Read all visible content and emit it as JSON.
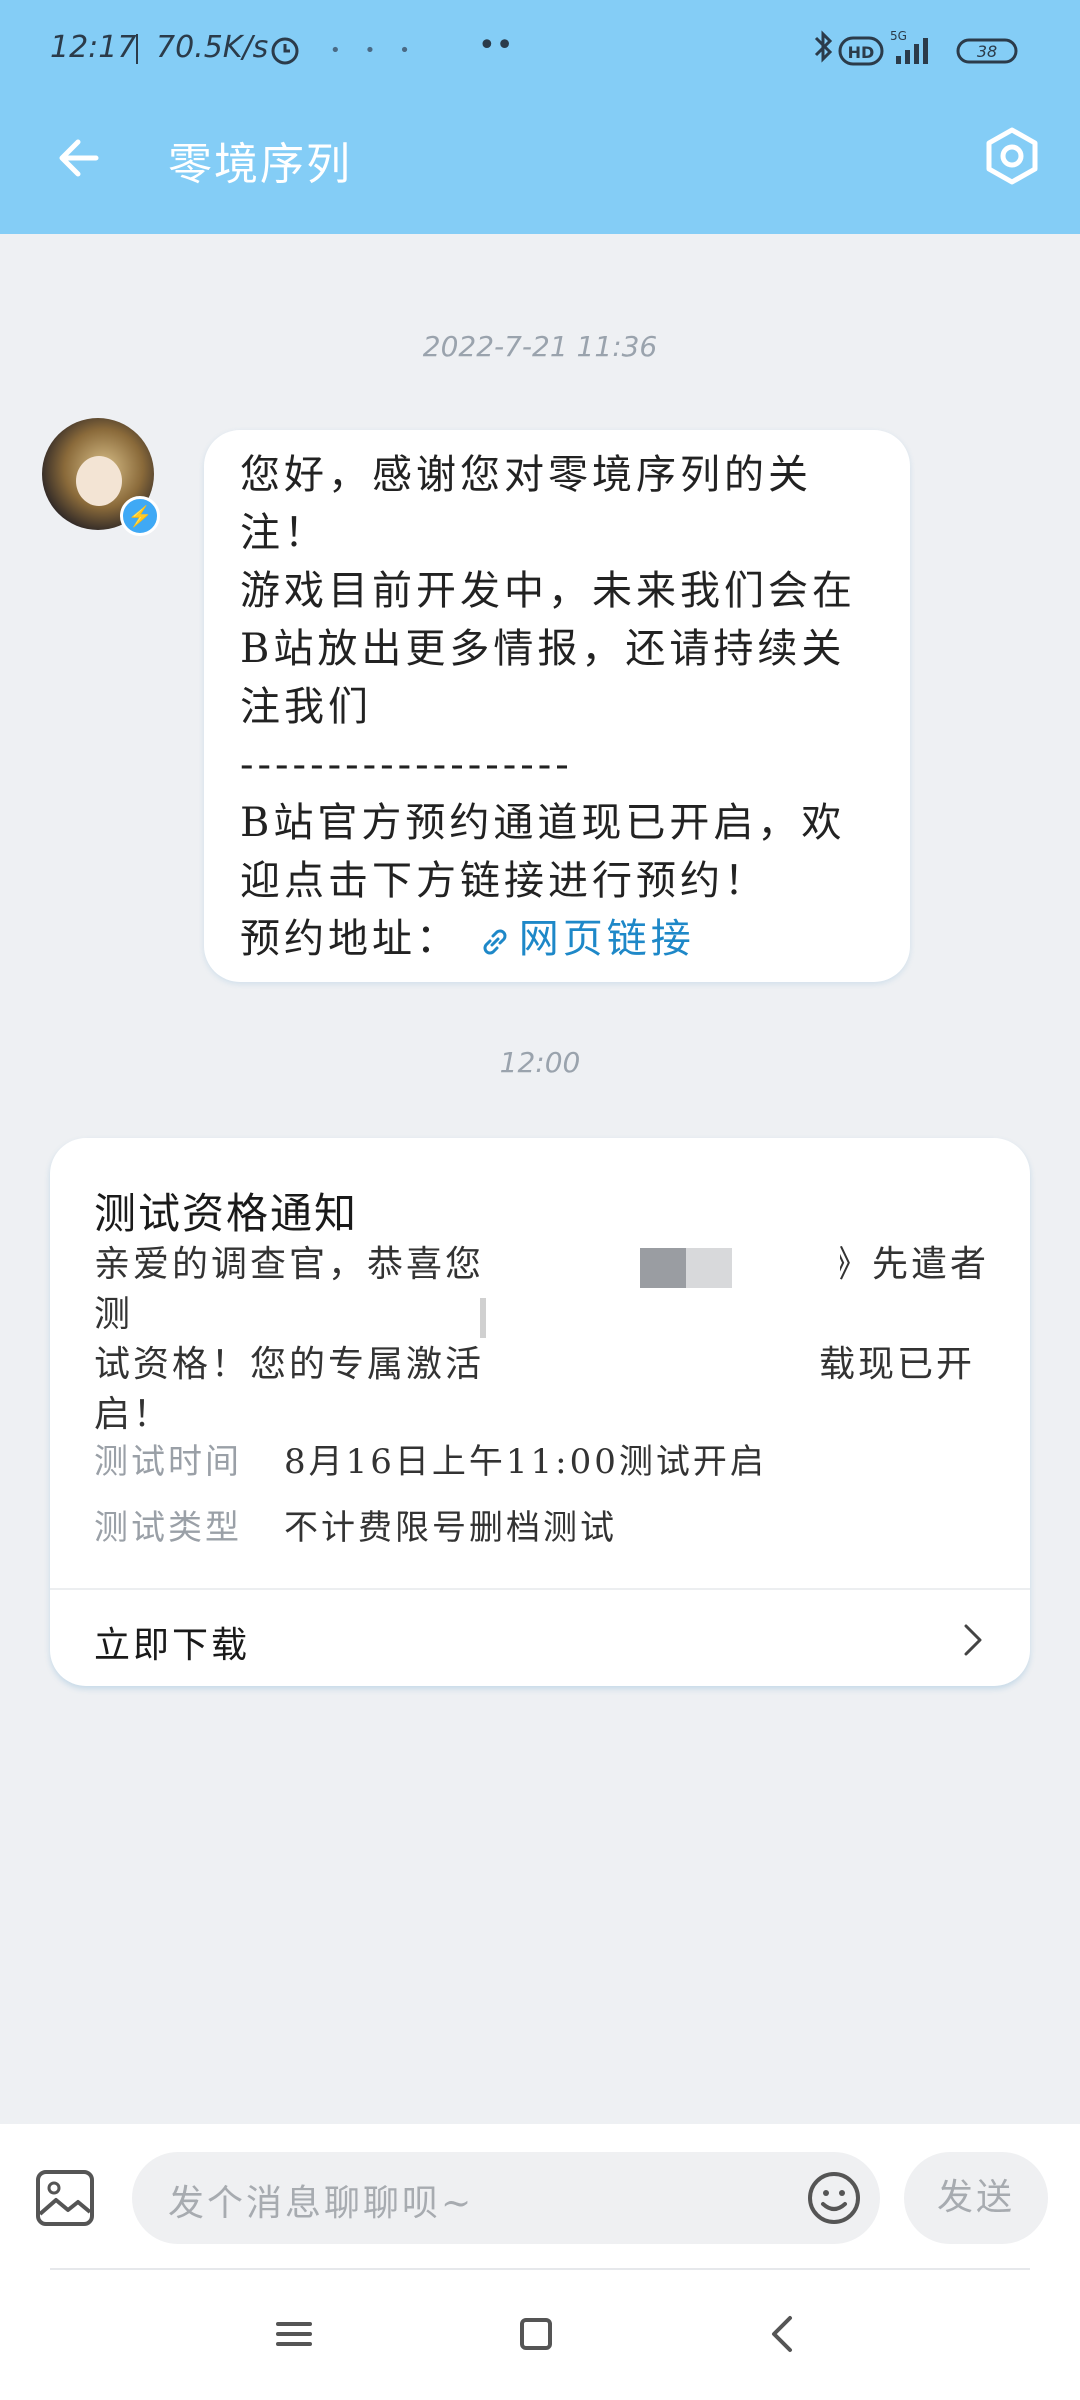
{
  "status_bar": {
    "time": "12:17",
    "network_speed": "70.5K/s",
    "network_type": "5G",
    "hd_label": "HD",
    "battery": "38"
  },
  "header": {
    "title": "零境序列",
    "back_icon": "arrow-left-icon",
    "settings_icon": "hexagon-settings-icon"
  },
  "colors": {
    "header_bg": "#84cdf6",
    "link": "#1e88c8"
  },
  "messages": [
    {
      "timestamp": "2022-7-21 11:36",
      "lines": [
        "您好，感谢您对零境序列的关",
        "注！",
        "游戏目前开发中，未来我们会在",
        "B站放出更多情报，还请持续关",
        "注我们",
        "-------------------",
        "B站官方预约通道现已开启，欢",
        "迎点击下方链接进行预约！"
      ],
      "link_prefix": "预约地址：",
      "link_text": "网页链接"
    }
  ],
  "card": {
    "timestamp": "12:00",
    "title": "测试资格通知",
    "body_line1": "亲爱的调查官，恭喜您",
    "body_line1_end": "列》先遣者测",
    "body_line2": "试资格！您的专属激活",
    "body_line2_end": "载现已开",
    "body_line3": "启！",
    "rows": [
      {
        "label": "测试时间",
        "value": "8月16日上午11:00测试开启"
      },
      {
        "label": "测试类型",
        "value": "不计费限号删档测试"
      }
    ],
    "action": "立即下载"
  },
  "composer": {
    "placeholder": "发个消息聊聊呗~",
    "send": "发送"
  }
}
